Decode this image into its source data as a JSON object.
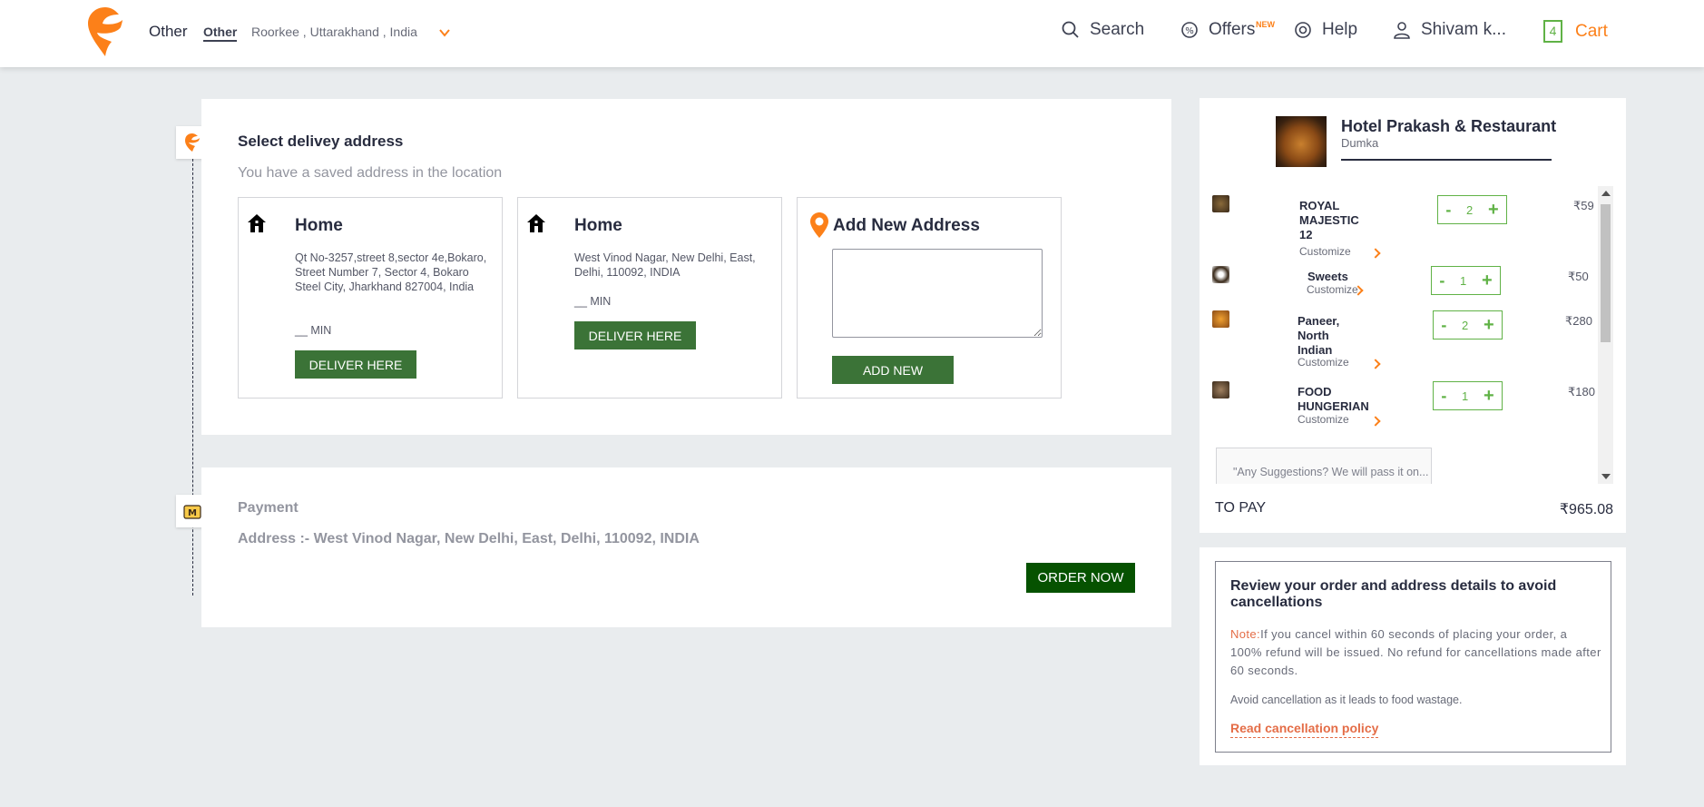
{
  "header": {
    "location_primary": "Other",
    "location_tag": "Other",
    "location_text": "Roorkee , Uttarakhand , India",
    "nav": {
      "search": "Search",
      "offers": "Offers",
      "offers_badge": "NEW",
      "help": "Help",
      "user": "Shivam k...",
      "cart_count": "4",
      "cart": "Cart"
    }
  },
  "address_section": {
    "title": "Select delivey address",
    "subtitle": "You have a saved address in the location",
    "cards": [
      {
        "title": "Home",
        "address": "Qt No-3257,street 8,sector 4e,Bokaro, Street Number 7, Sector 4, Bokaro Steel City, Jharkhand 827004, India",
        "eta": "__ MIN",
        "button": "DELIVER HERE"
      },
      {
        "title": "Home",
        "address": "West Vinod Nagar, New Delhi, East, Delhi, 110092, INDIA",
        "eta": "__ MIN",
        "button": "DELIVER HERE"
      }
    ],
    "add_new": {
      "title": "Add New Address",
      "button": "ADD NEW"
    }
  },
  "payment": {
    "title": "Payment",
    "address": "Address :- West Vinod Nagar, New Delhi, East, Delhi, 110092, INDIA",
    "order_button": "ORDER NOW"
  },
  "cart": {
    "restaurant_name": "Hotel Prakash & Restaurant",
    "restaurant_location": "Dumka",
    "items": [
      {
        "name": "ROYAL MAJESTIC 12",
        "customize": "Customize",
        "qty": "2",
        "price": "₹59"
      },
      {
        "name": "Sweets",
        "customize": "Customize",
        "qty": "1",
        "price": "₹50"
      },
      {
        "name": "Paneer, North Indian",
        "customize": "Customize",
        "qty": "2",
        "price": "₹280"
      },
      {
        "name": "FOOD HUNGERIAN",
        "customize": "Customize",
        "qty": "1",
        "price": "₹180"
      }
    ],
    "suggestions_placeholder": "\"Any Suggestions? We will pass it on...",
    "to_pay_label": "TO PAY",
    "to_pay_value": "₹965.08",
    "stepper_minus": "-",
    "stepper_plus": "+"
  },
  "review": {
    "title": "Review your order and address details to avoid cancellations",
    "note_label": "Note:",
    "note_text": "If you cancel within 60 seconds of placing your order, a 100% refund will be issued. No refund for cancellations made after 60 seconds.",
    "avoid_text": "Avoid cancellation as it leads to food wastage.",
    "policy_link": "Read cancellation policy"
  },
  "colors": {
    "brand_orange": "#fc8019",
    "deliver_green": "#3b7337",
    "order_green": "#065200",
    "stepper_green": "#60b246",
    "note_red": "#e46d47"
  }
}
